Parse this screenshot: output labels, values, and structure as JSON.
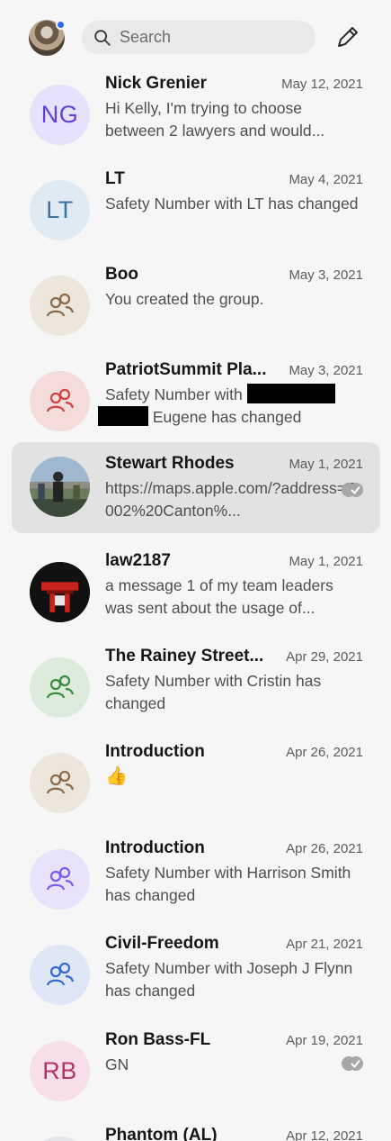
{
  "search": {
    "placeholder": "Search"
  },
  "colors": {
    "accent": "#2c6bed",
    "selected_row": "#e2e2e2",
    "group_purple": "#7b5cf0",
    "group_red": "#d0423f",
    "group_green": "#3c8a3c",
    "group_blue": "#3768d8",
    "group_tan": "#8a6a4a"
  },
  "conversations": [
    {
      "name": "Nick Grenier",
      "date": "May 12, 2021",
      "snippet": "Hi Kelly, I'm trying to choose between 2 lawyers and would...",
      "avatar": {
        "type": "initials",
        "text": "NG",
        "bg": "#e6e2fb",
        "fg": "#6540d9"
      }
    },
    {
      "name": "LT",
      "date": "May 4, 2021",
      "snippet": "Safety Number with LT has changed",
      "avatar": {
        "type": "initials",
        "text": "LT",
        "bg": "#dfeaf3",
        "fg": "#3b73a4"
      }
    },
    {
      "name": "Boo",
      "date": "May 3, 2021",
      "snippet": "You created the group.",
      "avatar": {
        "type": "group",
        "icon": "group-icon",
        "bg": "#ece6dc",
        "fg": "#8a6a4a"
      }
    },
    {
      "name": "PatriotSummit Pla...",
      "date": "May 3, 2021",
      "snippet_a": "Safety Number with",
      "snippet_b": "Eugene has changed",
      "avatar": {
        "type": "group",
        "icon": "group-icon",
        "bg": "#f4dcda",
        "fg": "#d0423f"
      }
    },
    {
      "name": "Stewart Rhodes",
      "date": "May 1, 2021",
      "snippet": "https://maps.apple.com/?address=7002%20Canton%...",
      "avatar": {
        "type": "photo"
      },
      "status": "read-receipt-icon",
      "selected": true
    },
    {
      "name": "law2187",
      "date": "May 1, 2021",
      "snippet": "a message 1 of my team leaders was sent about the usage of...",
      "avatar": {
        "type": "photo"
      }
    },
    {
      "name": "The Rainey Street...",
      "date": "Apr 29, 2021",
      "snippet": "Safety Number with Cristin has changed",
      "avatar": {
        "type": "group",
        "icon": "group-icon",
        "bg": "#dcebdc",
        "fg": "#3c8a3c"
      }
    },
    {
      "name": "Introduction",
      "date": "Apr 26, 2021",
      "snippet": "👍",
      "avatar": {
        "type": "group",
        "icon": "group-icon",
        "bg": "#ece6dc",
        "fg": "#8a6a4a"
      }
    },
    {
      "name": "Introduction",
      "date": "Apr 26, 2021",
      "snippet": "Safety Number with Harrison Smith has changed",
      "avatar": {
        "type": "group",
        "icon": "group-icon",
        "bg": "#e8e2fb",
        "fg": "#7b5cf0"
      }
    },
    {
      "name": "Civil-Freedom",
      "date": "Apr 21, 2021",
      "snippet": "Safety Number with Joseph J Flynn has changed",
      "avatar": {
        "type": "group",
        "icon": "group-icon",
        "bg": "#dfe7f7",
        "fg": "#3768d8"
      }
    },
    {
      "name": "Ron Bass-FL",
      "date": "Apr 19, 2021",
      "snippet": "GN",
      "avatar": {
        "type": "initials",
        "text": "RB",
        "bg": "#f6dfe8",
        "fg": "#b5326b"
      },
      "status": "read-receipt-icon"
    },
    {
      "name": "Phantom (AL)",
      "date": "Apr 12, 2021",
      "snippet": "",
      "avatar": {
        "type": "initials",
        "text": "",
        "bg": "#e3e6ea",
        "fg": "#56616b"
      }
    }
  ]
}
